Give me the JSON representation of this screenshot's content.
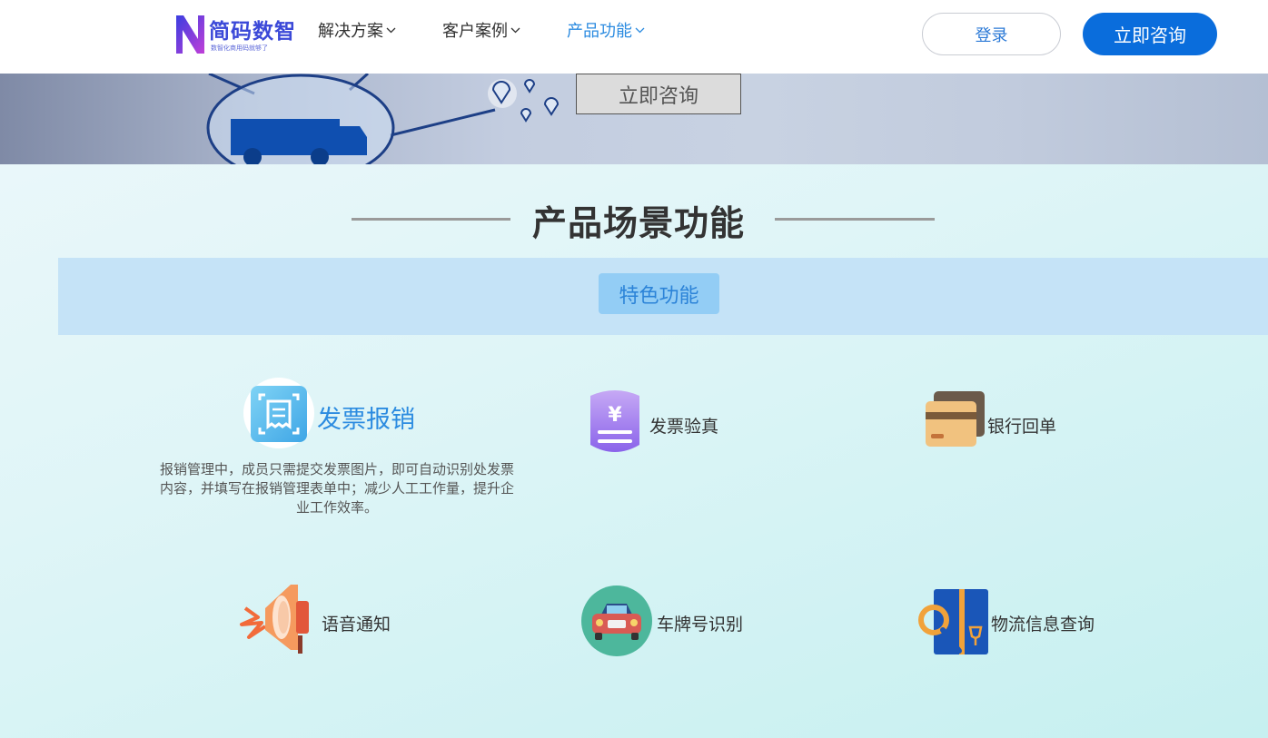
{
  "brand": {
    "name": "简码数智",
    "slogan": "数智化商用码就够了"
  },
  "nav": {
    "items": [
      {
        "label": "解决方案"
      },
      {
        "label": "客户案例"
      },
      {
        "label": "产品功能"
      }
    ],
    "login_label": "登录",
    "consult_label": "立即咨询"
  },
  "banner": {
    "button_label": "立即咨询"
  },
  "section": {
    "title": "产品场景功能"
  },
  "tabs": {
    "active_label": "特色功能"
  },
  "features": [
    {
      "label": "发票报销",
      "description": "报销管理中，成员只需提交发票图片，即可自动识别处发票内容，并填写在报销管理表单中；减少人工工作量，提升企业工作效率。",
      "icon": "receipt-scan-icon"
    },
    {
      "label": "发票验真",
      "icon": "yen-invoice-icon"
    },
    {
      "label": "银行回单",
      "icon": "bank-card-icon"
    },
    {
      "label": "语音通知",
      "icon": "megaphone-icon"
    },
    {
      "label": "车牌号识别",
      "icon": "car-icon"
    },
    {
      "label": "物流信息查询",
      "icon": "logistics-search-icon"
    }
  ],
  "colors": {
    "accent": "#0a6ddc",
    "nav_active": "#2b8be0",
    "tab_strip": "#c5e3f7",
    "tab_active": "#93cdf5"
  }
}
